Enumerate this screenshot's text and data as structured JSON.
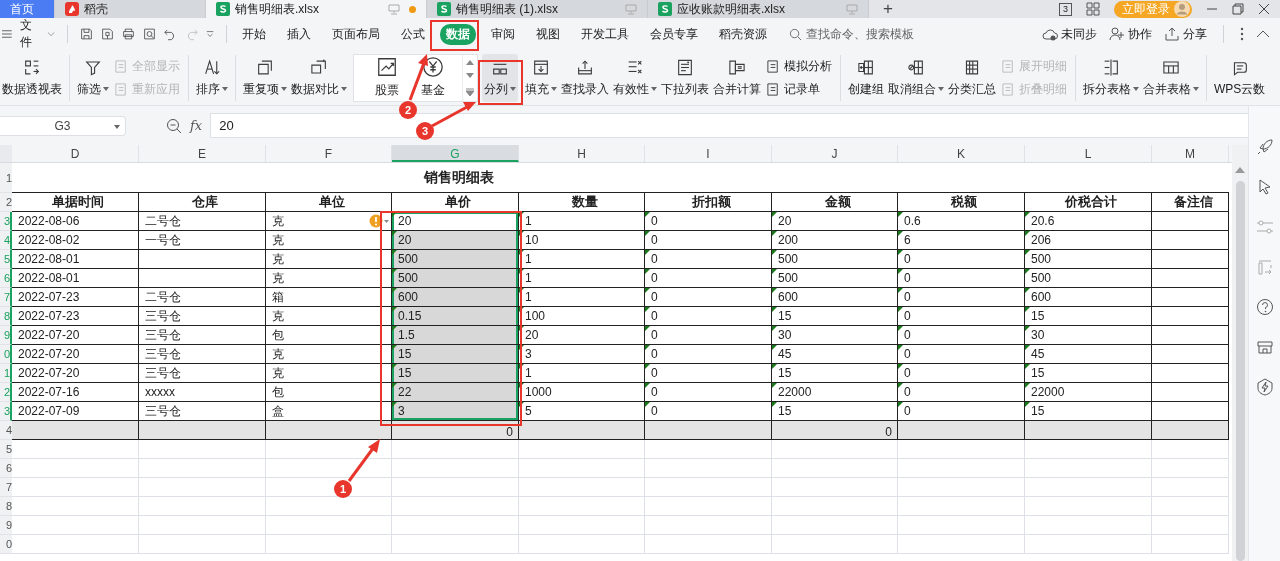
{
  "tabs": [
    {
      "label": "首页",
      "kind": "home",
      "selected": false
    },
    {
      "label": "稻壳",
      "kind": "docer",
      "selected": false
    },
    {
      "label": "销售明细表.xlsx",
      "kind": "sheet",
      "selected": true,
      "unsaved": true
    },
    {
      "label": "销售明细表 (1).xlsx",
      "kind": "sheet",
      "selected": false,
      "unsaved": false
    },
    {
      "label": "应收账款明细表.xlsx",
      "kind": "sheet",
      "selected": false,
      "unsaved": false
    }
  ],
  "new_tab": "+",
  "window_controls": {
    "badge": "3",
    "login": "立即登录"
  },
  "menu": {
    "file": "文件",
    "tabs": [
      {
        "label": "开始",
        "selected": false
      },
      {
        "label": "插入",
        "selected": false
      },
      {
        "label": "页面布局",
        "selected": false
      },
      {
        "label": "公式",
        "selected": false
      },
      {
        "label": "数据",
        "selected": true
      },
      {
        "label": "审阅",
        "selected": false
      },
      {
        "label": "视图",
        "selected": false
      },
      {
        "label": "开发工具",
        "selected": false
      },
      {
        "label": "会员专享",
        "selected": false
      },
      {
        "label": "稻壳资源",
        "selected": false
      }
    ],
    "search": {
      "placeholder": "查找命令、搜索模板"
    },
    "actions": [
      "未同步",
      "协作",
      "分享"
    ]
  },
  "ribbon": [
    {
      "kind": "large",
      "label": "数据透视表",
      "dropdown": false,
      "highlighted": false
    },
    {
      "kind": "separator"
    },
    {
      "kind": "large",
      "label": "筛选",
      "dropdown": true,
      "highlighted": false
    },
    {
      "kind": "stack",
      "items": [
        {
          "label": "全部显示",
          "disabled": true
        },
        {
          "label": "重新应用",
          "disabled": true
        }
      ]
    },
    {
      "kind": "separator"
    },
    {
      "kind": "large",
      "label": "排序",
      "dropdown": true,
      "highlighted": false
    },
    {
      "kind": "separator"
    },
    {
      "kind": "large",
      "label": "重复项",
      "dropdown": true,
      "highlighted": false
    },
    {
      "kind": "large",
      "label": "数据对比",
      "dropdown": true,
      "highlighted": false
    },
    {
      "kind": "gallery",
      "items": [
        {
          "label": "股票"
        },
        {
          "label": "基金"
        }
      ]
    },
    {
      "kind": "large",
      "label": "分列",
      "dropdown": true,
      "highlighted": true
    },
    {
      "kind": "large",
      "label": "填充",
      "dropdown": true,
      "highlighted": false
    },
    {
      "kind": "large",
      "label": "查找录入",
      "dropdown": false,
      "highlighted": false
    },
    {
      "kind": "large",
      "label": "有效性",
      "dropdown": true,
      "highlighted": false
    },
    {
      "kind": "large",
      "label": "下拉列表",
      "dropdown": false,
      "highlighted": false
    },
    {
      "kind": "large",
      "label": "合并计算",
      "dropdown": false,
      "highlighted": false
    },
    {
      "kind": "stack",
      "items": [
        {
          "label": "模拟分析",
          "disabled": false
        },
        {
          "label": "记录单",
          "disabled": false
        }
      ]
    },
    {
      "kind": "separator"
    },
    {
      "kind": "large",
      "label": "创建组",
      "dropdown": false,
      "highlighted": false
    },
    {
      "kind": "large",
      "label": "取消组合",
      "dropdown": true,
      "highlighted": false
    },
    {
      "kind": "large",
      "label": "分类汇总",
      "dropdown": false,
      "highlighted": false
    },
    {
      "kind": "stack",
      "items": [
        {
          "label": "展开明细",
          "disabled": true
        },
        {
          "label": "折叠明细",
          "disabled": true
        }
      ]
    },
    {
      "kind": "separator"
    },
    {
      "kind": "large",
      "label": "拆分表格",
      "dropdown": true,
      "highlighted": false
    },
    {
      "kind": "large",
      "label": "合并表格",
      "dropdown": true,
      "highlighted": false
    },
    {
      "kind": "separator"
    },
    {
      "kind": "large",
      "label": "WPS云数",
      "dropdown": false,
      "highlighted": false
    }
  ],
  "formula_bar": {
    "name_box": "G3",
    "fx": "fx",
    "value": "20"
  },
  "sheet": {
    "columns": [
      {
        "letter": "D",
        "selected": false,
        "flagged": false
      },
      {
        "letter": "E",
        "selected": false,
        "flagged": false
      },
      {
        "letter": "F",
        "selected": false,
        "flagged": false
      },
      {
        "letter": "G",
        "selected": true,
        "flagged": true
      },
      {
        "letter": "H",
        "selected": false,
        "flagged": true
      },
      {
        "letter": "I",
        "selected": false,
        "flagged": true
      },
      {
        "letter": "J",
        "selected": false,
        "flagged": true
      },
      {
        "letter": "K",
        "selected": false,
        "flagged": true
      },
      {
        "letter": "L",
        "selected": false,
        "flagged": true
      },
      {
        "letter": "M",
        "selected": false
      }
    ],
    "title": "销售明细表",
    "rows": [
      {
        "number": "1",
        "kind": "title",
        "selected": false
      },
      {
        "number": "2",
        "kind": "header",
        "selected": false,
        "cells": [
          "单据时间",
          "仓库",
          "单位",
          "单价",
          "数量",
          "折扣额",
          "金额",
          "税额",
          "价税合计",
          "备注信"
        ]
      },
      {
        "number": "3",
        "kind": "data",
        "selected": true,
        "warning": true,
        "cells": [
          "2022-08-06",
          "二号仓",
          "克",
          "20",
          "1",
          "0",
          "20",
          "0.6",
          "20.6",
          null
        ]
      },
      {
        "number": "4",
        "kind": "data",
        "selected": true,
        "warning": false,
        "cells": [
          "2022-08-02",
          "一号仓",
          "克",
          "20",
          "10",
          "0",
          "200",
          "6",
          "206",
          null
        ]
      },
      {
        "number": "5",
        "kind": "data",
        "selected": true,
        "warning": false,
        "cells": [
          "2022-08-01",
          null,
          "克",
          "500",
          "1",
          "0",
          "500",
          "0",
          "500",
          null
        ]
      },
      {
        "number": "6",
        "kind": "data",
        "selected": true,
        "warning": false,
        "cells": [
          "2022-08-01",
          null,
          "克",
          "500",
          "1",
          "0",
          "500",
          "0",
          "500",
          null
        ]
      },
      {
        "number": "7",
        "kind": "data",
        "selected": true,
        "warning": false,
        "cells": [
          "2022-07-23",
          "二号仓",
          "箱",
          "600",
          "1",
          "0",
          "600",
          "0",
          "600",
          null
        ]
      },
      {
        "number": "8",
        "kind": "data",
        "selected": true,
        "warning": false,
        "cells": [
          "2022-07-23",
          "三号仓",
          "克",
          "0.15",
          "100",
          "0",
          "15",
          "0",
          "15",
          null
        ]
      },
      {
        "number": "9",
        "kind": "data",
        "selected": true,
        "warning": false,
        "cells": [
          "2022-07-20",
          "三号仓",
          "包",
          "1.5",
          "20",
          "0",
          "30",
          "0",
          "30",
          null
        ]
      },
      {
        "number": "0",
        "kind": "data",
        "selected": true,
        "warning": false,
        "cells": [
          "2022-07-20",
          "三号仓",
          "克",
          "15",
          "3",
          "0",
          "45",
          "0",
          "45",
          null
        ]
      },
      {
        "number": "1",
        "kind": "data",
        "selected": true,
        "warning": false,
        "cells": [
          "2022-07-20",
          "三号仓",
          "克",
          "15",
          "1",
          "0",
          "15",
          "0",
          "15",
          null
        ]
      },
      {
        "number": "2",
        "kind": "data",
        "selected": true,
        "warning": false,
        "cells": [
          "2022-07-16",
          "xxxxx",
          "包",
          "22",
          "1000",
          "0",
          "22000",
          "0",
          "22000",
          null
        ]
      },
      {
        "number": "3",
        "kind": "data",
        "selected": true,
        "warning": false,
        "cells": [
          "2022-07-09",
          "三号仓",
          "盒",
          "3",
          "5",
          "0",
          "15",
          "0",
          "15",
          null
        ]
      },
      {
        "number": "4",
        "kind": "total",
        "selected": false,
        "cells": [
          null,
          null,
          null,
          "0",
          null,
          null,
          "0",
          null,
          null,
          null
        ]
      },
      {
        "number": "5",
        "kind": "empty",
        "selected": false
      },
      {
        "number": "6",
        "kind": "empty",
        "selected": false
      },
      {
        "number": "7",
        "kind": "empty",
        "selected": false
      },
      {
        "number": "8",
        "kind": "empty",
        "selected": false
      },
      {
        "number": "9",
        "kind": "empty",
        "selected": false
      },
      {
        "number": "0",
        "kind": "empty",
        "selected": false
      }
    ]
  },
  "annotations": [
    {
      "label": "1"
    },
    {
      "label": "2"
    },
    {
      "label": "3"
    }
  ]
}
